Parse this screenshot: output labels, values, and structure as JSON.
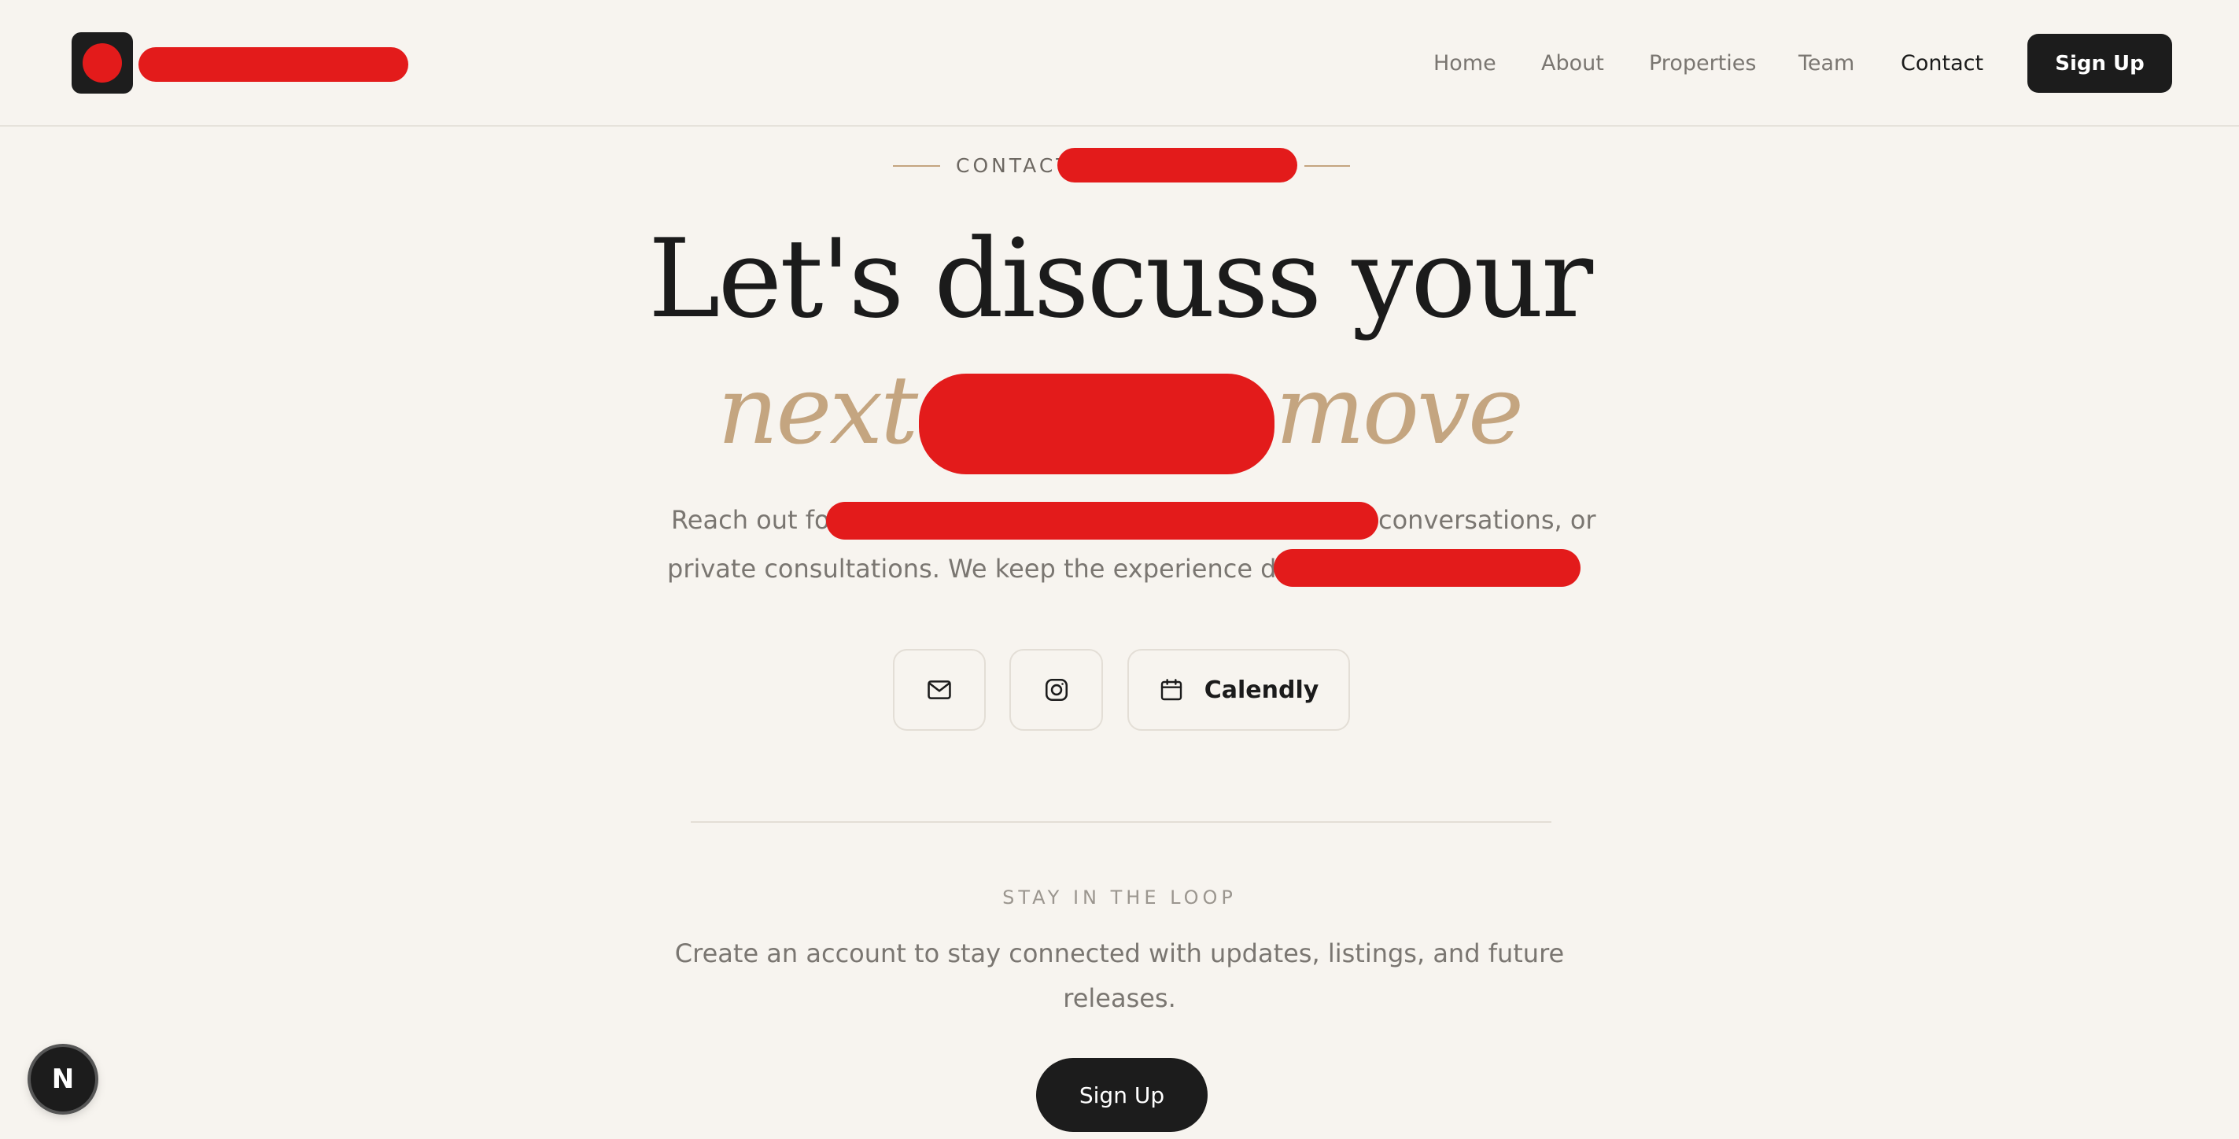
{
  "header": {
    "brand_name": "",
    "nav": [
      "Home",
      "About",
      "Properties",
      "Team",
      "Contact"
    ],
    "active_nav": "Contact",
    "signup_label": "Sign Up"
  },
  "hero": {
    "eyebrow": "CONTACT",
    "headline_line1": "Let's discuss your",
    "headline_line2_start": "next",
    "headline_line2_end": "move",
    "paragraph_line1_start": "Reach out for",
    "paragraph_line1_end": "conversations, or",
    "paragraph_line2_start": "private consultations. We keep the experience direct"
  },
  "contact_buttons": {
    "email_icon": "mail-icon",
    "instagram_icon": "instagram-icon",
    "calendar_icon": "calendar-icon",
    "calendly_label": "Calendly"
  },
  "newsletter": {
    "title": "STAY IN THE LOOP",
    "text_line1": "Create an account to stay connected with updates, listings, and future",
    "text_line2": "releases.",
    "signup_label": "Sign Up"
  },
  "dev_badge": {
    "letter": "N"
  },
  "colors": {
    "background": "#f7f4ef",
    "accent": "#c4a580",
    "dark": "#1c1c1c",
    "muted_text": "#7a7671",
    "redaction": "#e31b1b"
  }
}
